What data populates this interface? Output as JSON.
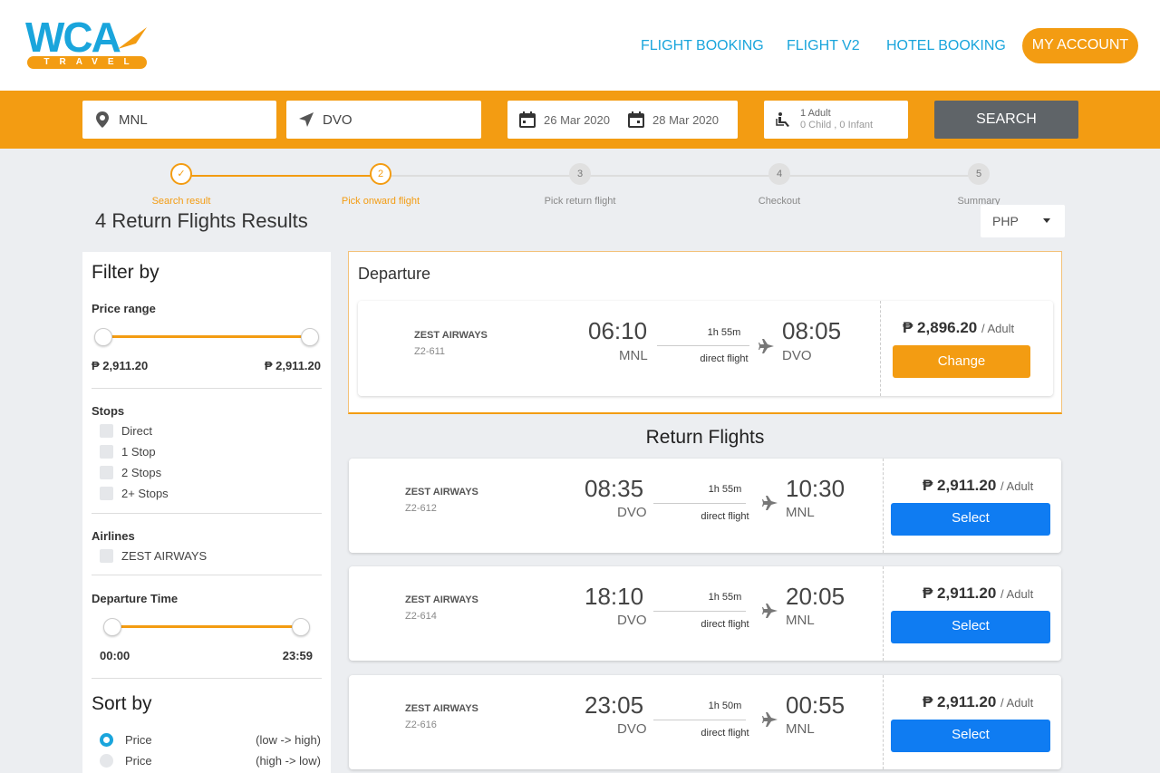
{
  "header": {
    "logo_text": "WCA",
    "logo_sub": "TRAVEL",
    "nav": [
      "FLIGHT BOOKING",
      "FLIGHT V2",
      "HOTEL BOOKING"
    ],
    "account_label": "MY ACCOUNT"
  },
  "search": {
    "origin": "MNL",
    "destination": "DVO",
    "depart_date": "26 Mar 2020",
    "return_date": "28 Mar 2020",
    "pax_adult": "1 Adult",
    "pax_other": "0 Child , 0 Infant",
    "button_label": "SEARCH"
  },
  "steps": [
    {
      "num": "✓",
      "label": "Search result"
    },
    {
      "num": "2",
      "label": "Pick onward flight"
    },
    {
      "num": "3",
      "label": "Pick return flight"
    },
    {
      "num": "4",
      "label": "Checkout"
    },
    {
      "num": "5",
      "label": "Summary"
    }
  ],
  "results_title": "4 Return Flights Results",
  "currency": "PHP",
  "filter": {
    "title": "Filter by",
    "price_label": "Price range",
    "price_min": "₱ 2,911.20",
    "price_max": "₱ 2,911.20",
    "stops_label": "Stops",
    "stops": [
      "Direct",
      "1 Stop",
      "2 Stops",
      "2+ Stops"
    ],
    "airlines_label": "Airlines",
    "airlines": [
      "ZEST AIRWAYS"
    ],
    "dep_time_label": "Departure Time",
    "time_min": "00:00",
    "time_max": "23:59"
  },
  "sort": {
    "title": "Sort by",
    "options": [
      {
        "label": "Price",
        "order": "(low -> high)"
      },
      {
        "label": "Price",
        "order": "(high -> low)"
      }
    ]
  },
  "departure": {
    "title": "Departure",
    "airline": "ZEST AIRWAYS",
    "code": "Z2-611",
    "dep_time": "06:10",
    "dep_airport": "MNL",
    "duration": "1h 55m",
    "type": "direct flight",
    "arr_time": "08:05",
    "arr_airport": "DVO",
    "price": "₱ 2,896.20",
    "per": "/ Adult",
    "button": "Change"
  },
  "return_title": "Return Flights",
  "returns": [
    {
      "airline": "ZEST AIRWAYS",
      "code": "Z2-612",
      "dep_time": "08:35",
      "dep_airport": "DVO",
      "duration": "1h 55m",
      "type": "direct flight",
      "arr_time": "10:30",
      "arr_airport": "MNL",
      "price": "₱ 2,911.20",
      "per": "/ Adult",
      "button": "Select"
    },
    {
      "airline": "ZEST AIRWAYS",
      "code": "Z2-614",
      "dep_time": "18:10",
      "dep_airport": "DVO",
      "duration": "1h 55m",
      "type": "direct flight",
      "arr_time": "20:05",
      "arr_airport": "MNL",
      "price": "₱ 2,911.20",
      "per": "/ Adult",
      "button": "Select"
    },
    {
      "airline": "ZEST AIRWAYS",
      "code": "Z2-616",
      "dep_time": "23:05",
      "dep_airport": "DVO",
      "duration": "1h 50m",
      "type": "direct flight",
      "arr_time": "00:55",
      "arr_airport": "MNL",
      "price": "₱ 2,911.20",
      "per": "/ Adult",
      "button": "Select"
    }
  ],
  "colors": {
    "brand_orange": "#f39c12",
    "brand_blue": "#1aa5dc",
    "select_blue": "#0f7cf2",
    "search_gray": "#5f6468"
  }
}
